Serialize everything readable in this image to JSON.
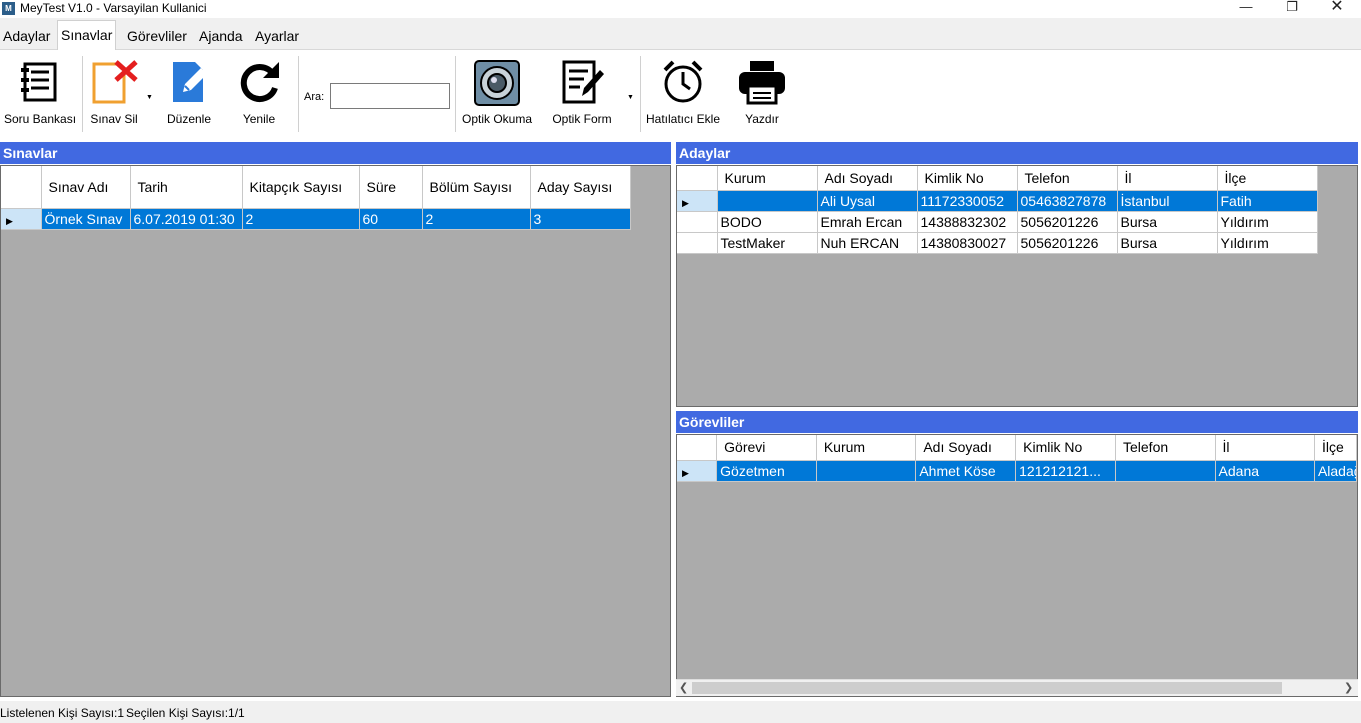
{
  "window": {
    "title": "MeyTest V1.0 - Varsayilan Kullanici",
    "icon": "app-logo-icon",
    "controls": [
      "minimize-icon",
      "restore-icon",
      "close-icon"
    ]
  },
  "tabs": [
    {
      "label": "Adaylar",
      "active": false
    },
    {
      "label": "Sınavlar",
      "active": true
    },
    {
      "label": "Görevliler",
      "active": false
    },
    {
      "label": "Ajanda",
      "active": false
    },
    {
      "label": "Ayarlar",
      "active": false
    }
  ],
  "toolbar": {
    "soru_bankasi": "Soru Bankası",
    "sinav_sil": "Sınav Sil",
    "duzenle": "Düzenle",
    "yenile": "Yenile",
    "search_label": "Ara:",
    "search_value": "",
    "optik_okuma": "Optik Okuma",
    "optik_form": "Optik Form",
    "hatirlatici_ekle": "Hatılatıcı Ekle",
    "yazdir": "Yazdır"
  },
  "exams": {
    "title": "Sınavlar",
    "columns": [
      "Sınav Adı",
      "Tarih",
      "Kitapçık Sayısı",
      "Süre",
      "Bölüm Sayısı",
      "Aday Sayısı"
    ],
    "rows": [
      {
        "ad": "Örnek Sınav",
        "tarih": "6.07.2019 01:30",
        "kitapcik": "2",
        "sure": "60",
        "bolum": "2",
        "aday": "3"
      }
    ]
  },
  "candidates": {
    "title": "Adaylar",
    "columns": [
      "Kurum",
      "Adı Soyadı",
      "Kimlik No",
      "Telefon",
      "İl",
      "İlçe"
    ],
    "rows": [
      {
        "kurum": "",
        "ad": "Ali Uysal",
        "kimlik": "11172330052",
        "tel": "05463827878",
        "il": "İstanbul",
        "ilce": "Fatih"
      },
      {
        "kurum": "BODO",
        "ad": "Emrah Ercan",
        "kimlik": "14388832302",
        "tel": "5056201226",
        "il": "Bursa",
        "ilce": "Yıldırım"
      },
      {
        "kurum": "TestMaker",
        "ad": "Nuh ERCAN",
        "kimlik": "14380830027",
        "tel": "5056201226",
        "il": "Bursa",
        "ilce": "Yıldırım"
      }
    ]
  },
  "staff": {
    "title": "Görevliler",
    "columns": [
      "Görevi",
      "Kurum",
      "Adı Soyadı",
      "Kimlik No",
      "Telefon",
      "İl",
      "İlçe"
    ],
    "rows": [
      {
        "gorev": "Gözetmen",
        "kurum": "",
        "ad": "Ahmet Köse",
        "kimlik": "121212121...",
        "tel": "",
        "il": "Adana",
        "ilce": "Aladağ"
      }
    ]
  },
  "status": {
    "listed": "Listelenen Kişi Sayısı:1",
    "selected": "Seçilen Kişi Sayısı:1/1"
  },
  "colors": {
    "panel_header": "#4169e1",
    "selection": "#0078d7",
    "grid_bg": "#ababab"
  }
}
